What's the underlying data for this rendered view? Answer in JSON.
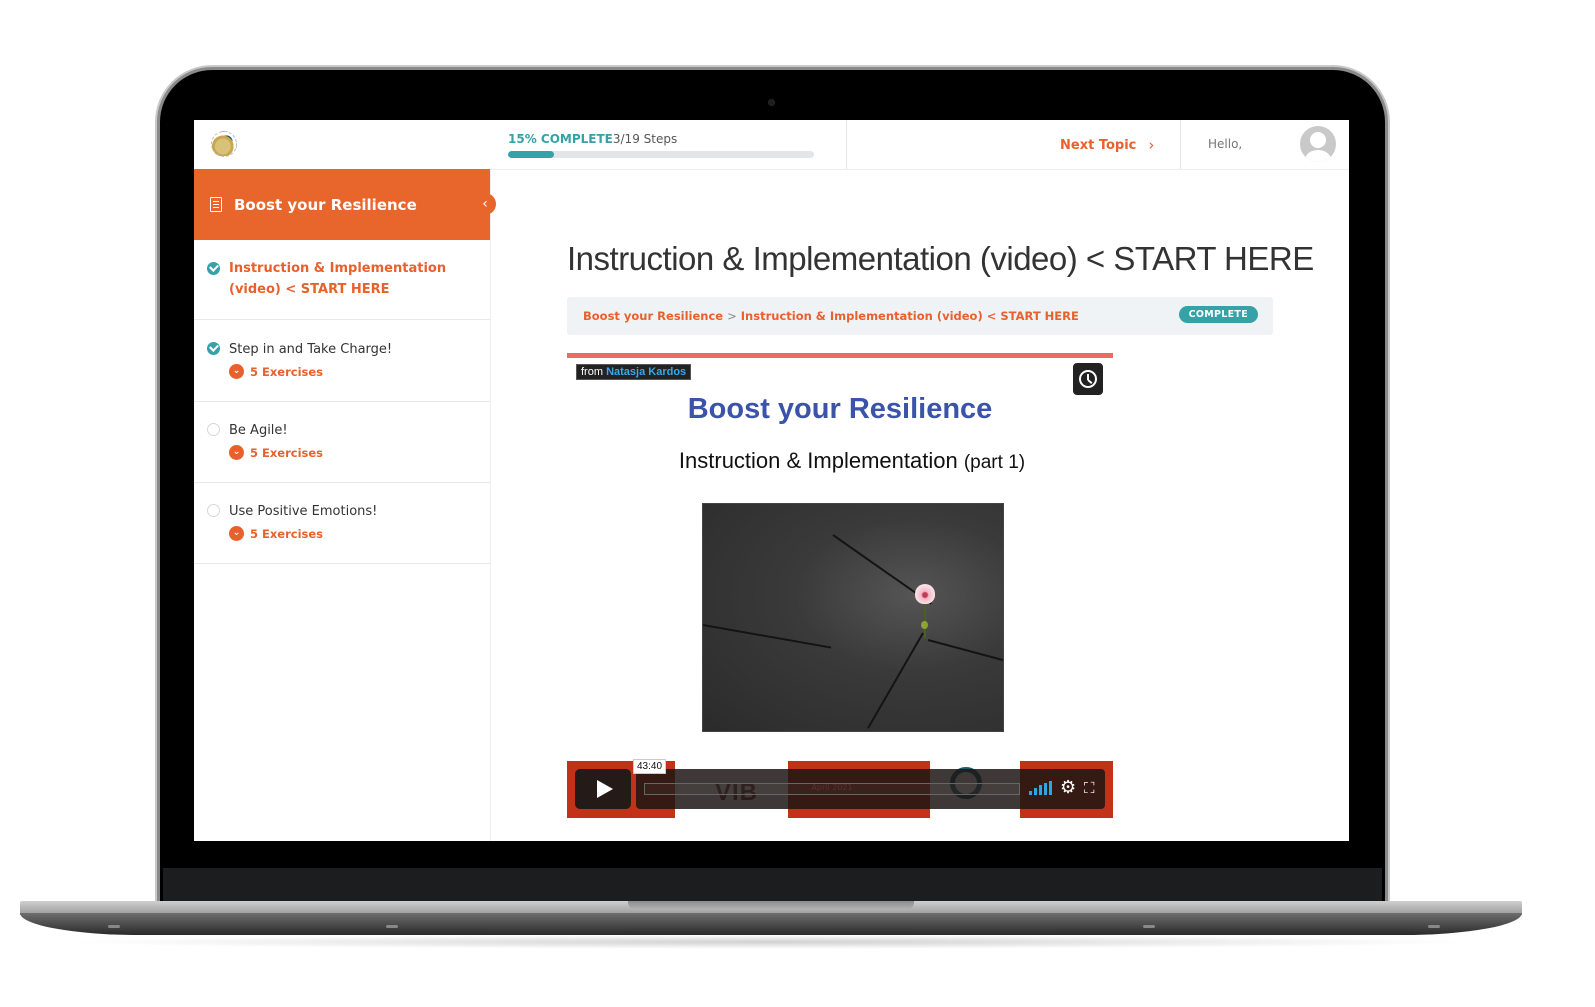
{
  "header": {
    "progress_percent_label": "15% COMPLETE",
    "progress_steps_label": "3/19 Steps",
    "progress_fraction": 0.15,
    "next_topic_label": "Next Topic",
    "greeting": "Hello,"
  },
  "sidebar": {
    "course_title": "Boost your Resilience",
    "lessons": [
      {
        "label": "Instruction & Implementation (video) < START HERE",
        "status": "complete",
        "active": true
      },
      {
        "label": "Step in and Take Charge!",
        "status": "complete",
        "exercises": "5 Exercises"
      },
      {
        "label": "Be Agile!",
        "status": "incomplete",
        "exercises": "5 Exercises"
      },
      {
        "label": "Use Positive Emotions!",
        "status": "incomplete",
        "exercises": "5 Exercises"
      }
    ]
  },
  "main": {
    "title": "Instruction & Implementation (video) < START HERE",
    "breadcrumb": {
      "course": "Boost your Resilience",
      "separator": ">",
      "lesson": "Instruction & Implementation (video) < START HERE"
    },
    "status_badge": "COMPLETE"
  },
  "video": {
    "byline_prefix": "from",
    "author": "Natasja Kardos",
    "slide_title": "Boost your Resilience",
    "slide_subtitle": "Instruction & Implementation",
    "slide_subtitle_part": "(part 1)",
    "duration": "43:40",
    "strip_vib": "VIB",
    "strip_date": "April 2021"
  },
  "colors": {
    "accent_orange": "#e8652c",
    "teal": "#35a2a7",
    "slide_blue": "#3b53a8",
    "video_red": "#c13218"
  }
}
